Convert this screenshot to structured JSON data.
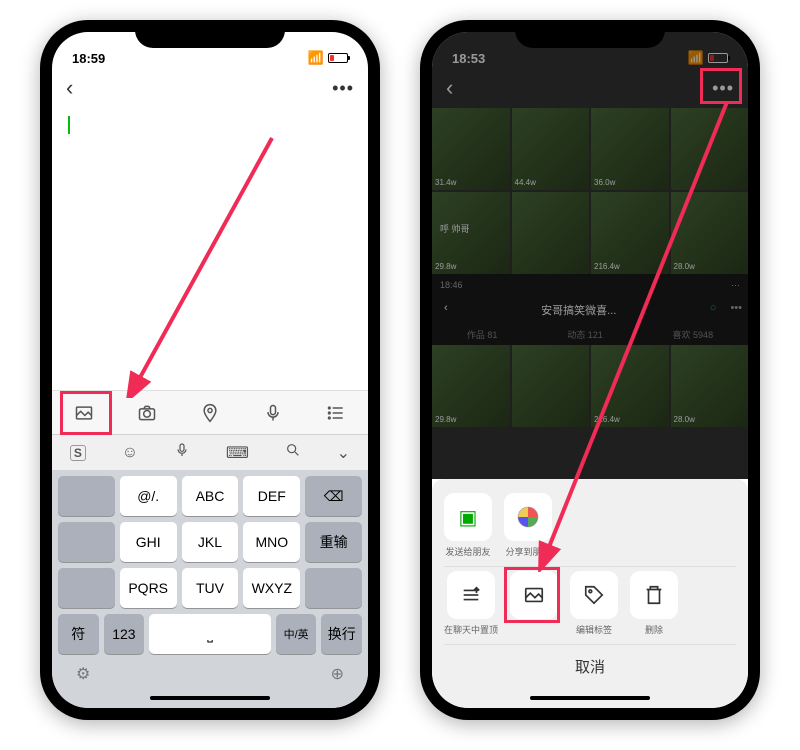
{
  "left": {
    "time": "18:59",
    "toolbar_icons": [
      "image-icon",
      "camera-icon",
      "location-icon",
      "mic-icon",
      "list-icon"
    ],
    "kb_top": [
      "S",
      "☺",
      "mic",
      "keyboard",
      "search",
      "down"
    ],
    "keys_row1": [
      "@/.",
      "ABC",
      "DEF"
    ],
    "keys_row2": [
      "GHI",
      "JKL",
      "MNO"
    ],
    "keys_row3": [
      "PQRS",
      "TUV",
      "WXYZ"
    ],
    "key_backspace": "⌫",
    "key_reinput": "重输",
    "key_sym": "符",
    "key_123": "123",
    "key_cn": "中/英",
    "key_enter": "换行"
  },
  "right": {
    "time": "18:53",
    "inner_time": "18:46",
    "profile_name": "安哥搞笑微喜...",
    "stat_works_label": "作品",
    "stat_works_val": "81",
    "stat_dyn_label": "动态",
    "stat_dyn_val": "121",
    "stat_like_label": "喜欢",
    "stat_like_val": "5948",
    "likes": [
      "31.4w",
      "44.4w",
      "36.0w",
      "",
      "29.8w",
      "",
      "216.4w",
      "28.0w",
      "",
      "",
      "",
      "",
      "29.8w",
      "",
      "216.4w",
      "28.0w"
    ],
    "share1_label": "发送给朋友",
    "share2_label": "分享到朋友",
    "action1_label": "在聊天中置顶",
    "action2_label": "",
    "action3_label": "编辑标签",
    "action4_label": "删除",
    "cancel": "取消",
    "caption": "呼 帅哥"
  }
}
